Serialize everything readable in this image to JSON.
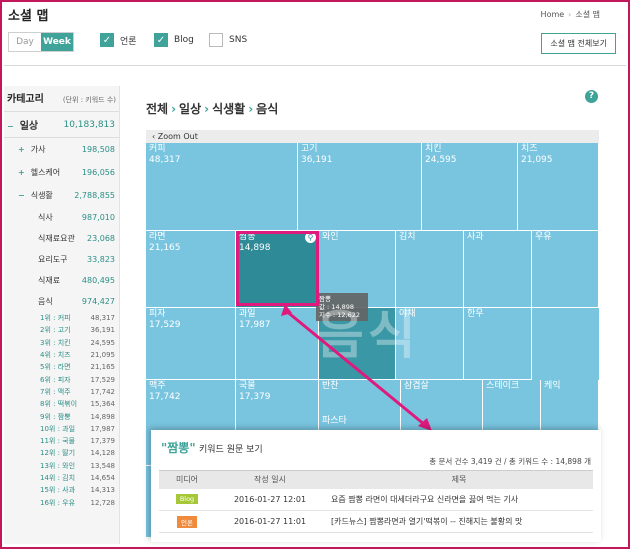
{
  "header": {
    "app_title": "소셜 맵",
    "breadcrumb": [
      "Home",
      "소셜 맵"
    ],
    "period": [
      "Day",
      "Week"
    ],
    "filters": [
      {
        "label": "언론",
        "checked": true
      },
      {
        "label": "Blog",
        "checked": true
      },
      {
        "label": "SNS",
        "checked": false
      }
    ],
    "all_button": "소셜 맵 전체보기",
    "check_glyph": "✓"
  },
  "sidebar": {
    "title": "카테고리",
    "unit": "(단위 : 키워드 수)",
    "top": {
      "label": "일상",
      "value": "10,183,813",
      "toggle": "−"
    },
    "groups": [
      {
        "label": "가사",
        "value": "198,508",
        "toggle": "+"
      },
      {
        "label": "헬스케어",
        "value": "196,056",
        "toggle": "+"
      },
      {
        "label": "식생활",
        "value": "2,788,855",
        "toggle": "−"
      }
    ],
    "subs": [
      {
        "label": "식사",
        "value": "987,010"
      },
      {
        "label": "식재료요관",
        "value": "23,068"
      },
      {
        "label": "요리도구",
        "value": "33,823"
      },
      {
        "label": "식재료",
        "value": "480,495"
      },
      {
        "label": "음식",
        "value": "974,427"
      }
    ],
    "ranks": [
      {
        "label": "1위 : 커피",
        "value": "48,317"
      },
      {
        "label": "2위 : 고기",
        "value": "36,191"
      },
      {
        "label": "3위 : 치킨",
        "value": "24,595"
      },
      {
        "label": "4위 : 치즈",
        "value": "21,095"
      },
      {
        "label": "5위 : 라면",
        "value": "21,165"
      },
      {
        "label": "6위 : 피자",
        "value": "17,529"
      },
      {
        "label": "7위 : 맥주",
        "value": "17,742"
      },
      {
        "label": "8위 : 떡볶이",
        "value": "15,364"
      },
      {
        "label": "9위 : 짬뽕",
        "value": "14,898"
      },
      {
        "label": "10위 : 과일",
        "value": "17,987"
      },
      {
        "label": "11위 : 국물",
        "value": "17,379"
      },
      {
        "label": "12위 : 딸기",
        "value": "14,128"
      },
      {
        "label": "13위 : 와인",
        "value": "13,548"
      },
      {
        "label": "14위 : 김치",
        "value": "14,654"
      },
      {
        "label": "15위 : 사과",
        "value": "14,313"
      },
      {
        "label": "16위 : 우유",
        "value": "12,728"
      }
    ]
  },
  "main": {
    "breadcrumb": [
      "전체",
      "일상",
      "식생활",
      "음식"
    ],
    "bc_sep": "›",
    "help": "?",
    "zoom_out": "Zoom Out",
    "zoom_out_glyph": "‹",
    "watermark": "음식",
    "tooltip": {
      "name": "짬뽕",
      "line1": "값 : 14,898",
      "line2": "지수 : 12,622"
    },
    "zoom_glyph": "⚲",
    "cells": [
      {
        "label": "커피",
        "value": "48,317"
      },
      {
        "label": "고기",
        "value": "36,191"
      },
      {
        "label": "치킨",
        "value": "24,595"
      },
      {
        "label": "치즈",
        "value": "21,095"
      },
      {
        "label": "라면",
        "value": "21,165"
      },
      {
        "label": "짬뽕",
        "value": "14,898"
      },
      {
        "label": "와인",
        "value": ""
      },
      {
        "label": "김치",
        "value": ""
      },
      {
        "label": "사과",
        "value": ""
      },
      {
        "label": "우유",
        "value": ""
      },
      {
        "label": "피자",
        "value": "17,529"
      },
      {
        "label": "과일",
        "value": "17,987"
      },
      {
        "label": "과자",
        "value": ""
      },
      {
        "label": "야채",
        "value": ""
      },
      {
        "label": "한우",
        "value": ""
      },
      {
        "label": "맥주",
        "value": "17,742"
      },
      {
        "label": "국물",
        "value": "17,379"
      },
      {
        "label": "반찬",
        "value": ""
      },
      {
        "label": "삼겹살",
        "value": ""
      },
      {
        "label": "스테이크",
        "value": ""
      },
      {
        "label": "케익",
        "value": ""
      },
      {
        "label": "파스타",
        "value": ""
      }
    ]
  },
  "popup": {
    "keyword": "\"짬뽕\"",
    "title": "키워드 원문 보기",
    "summary": "총 문서 건수 3,419 건 / 총 키워드 수 : 14,898 개",
    "columns": [
      "미디어",
      "작성 일시",
      "제목"
    ],
    "rows": [
      {
        "media": "Blog",
        "media_color": "#a6c837",
        "date": "2016-01-27 12:01",
        "title": "요즘 짬뽕 라면이 대세더라구요 신라면을 끓여 먹는 기사"
      },
      {
        "media": "언론",
        "media_color": "#f08a3c",
        "date": "2016-01-27 11:01",
        "title": "[카드뉴스] 짬뽕라면과 열기'떡볶이 -- 진해지는 불황의 맛"
      }
    ]
  },
  "colors": {
    "accent": "#3fa39a",
    "treemap": "#79c5e0",
    "highlight": "#e0197d",
    "dark_cell": "#2f8a98"
  }
}
